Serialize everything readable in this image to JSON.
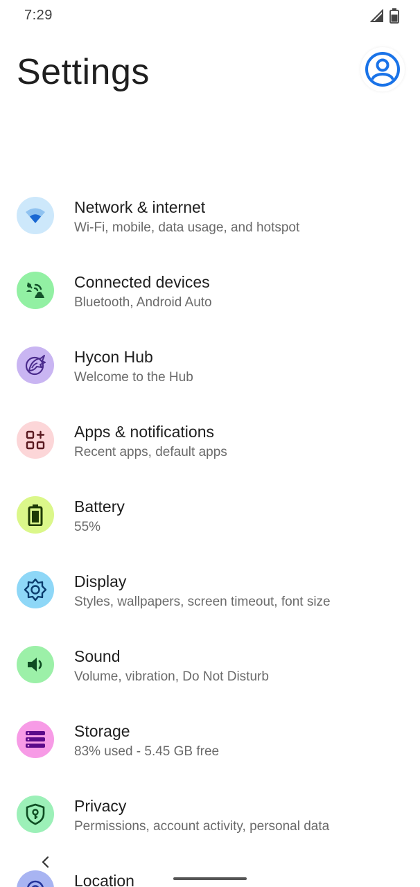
{
  "status_bar": {
    "time": "7:29"
  },
  "header": {
    "title": "Settings"
  },
  "colors": {
    "accent": "#1a73e8"
  },
  "settings": [
    {
      "id": "network",
      "title": "Network & internet",
      "subtitle": "Wi-Fi, mobile, data usage, and hotspot",
      "icon": "wifi-icon",
      "bg": "#cde8fb",
      "fg": "#1967d2"
    },
    {
      "id": "connected",
      "title": "Connected devices",
      "subtitle": "Bluetooth, Android Auto",
      "icon": "connected-devices-icon",
      "bg": "#92f0a3",
      "fg": "#13532a"
    },
    {
      "id": "hycon",
      "title": "Hycon Hub",
      "subtitle": "Welcome to the Hub",
      "icon": "hycon-wolf-icon",
      "bg": "#c9b5f2",
      "fg": "#4a2a8c"
    },
    {
      "id": "apps",
      "title": "Apps & notifications",
      "subtitle": "Recent apps, default apps",
      "icon": "apps-grid-icon",
      "bg": "#fcd6d8",
      "fg": "#5a1a20"
    },
    {
      "id": "battery",
      "title": "Battery",
      "subtitle": "55%",
      "icon": "battery-icon",
      "bg": "#dbf78a",
      "fg": "#1e3a05"
    },
    {
      "id": "display",
      "title": "Display",
      "subtitle": "Styles, wallpapers, screen timeout, font size",
      "icon": "display-gear-icon",
      "bg": "#8ed7f7",
      "fg": "#0b3c6e"
    },
    {
      "id": "sound",
      "title": "Sound",
      "subtitle": "Volume, vibration, Do Not Disturb",
      "icon": "speaker-icon",
      "bg": "#9cf0a8",
      "fg": "#0e4c22"
    },
    {
      "id": "storage",
      "title": "Storage",
      "subtitle": "83% used - 5.45 GB free",
      "icon": "storage-icon",
      "bg": "#f79be6",
      "fg": "#5b0a8a"
    },
    {
      "id": "privacy",
      "title": "Privacy",
      "subtitle": "Permissions, account activity, personal data",
      "icon": "privacy-shield-icon",
      "bg": "#9cf0b8",
      "fg": "#0e4c22"
    },
    {
      "id": "location",
      "title": "Location",
      "subtitle": "",
      "icon": "location-icon",
      "bg": "#a8b4f2",
      "fg": "#24339a"
    }
  ]
}
